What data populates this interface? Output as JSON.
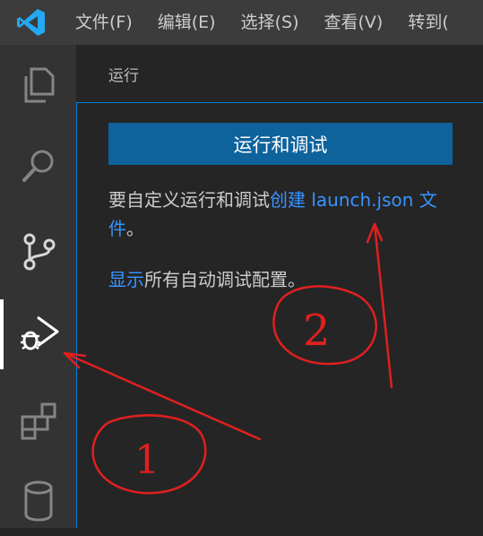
{
  "menubar": {
    "items": [
      "文件(F)",
      "编辑(E)",
      "选择(S)",
      "查看(V)",
      "转到("
    ]
  },
  "activity_bar": {
    "items": [
      {
        "icon": "files-icon"
      },
      {
        "icon": "search-icon"
      },
      {
        "icon": "source-control-icon"
      },
      {
        "icon": "run-debug-icon",
        "active": true
      },
      {
        "icon": "extensions-icon"
      },
      {
        "icon": "database-icon"
      }
    ]
  },
  "sidebar": {
    "title": "运行",
    "button_label": "运行和调试",
    "message1": {
      "prefix": "要自定义运行和调试",
      "link": "创建 launch.json 文件",
      "suffix": "。"
    },
    "message2": {
      "link": "显示",
      "suffix": "所有自动调试配置。"
    }
  },
  "annotations": {
    "labels": [
      "1",
      "2"
    ],
    "color": "#e0201f"
  },
  "colors": {
    "accent": "#007acc",
    "button": "#0e639c",
    "link": "#3794ff"
  }
}
